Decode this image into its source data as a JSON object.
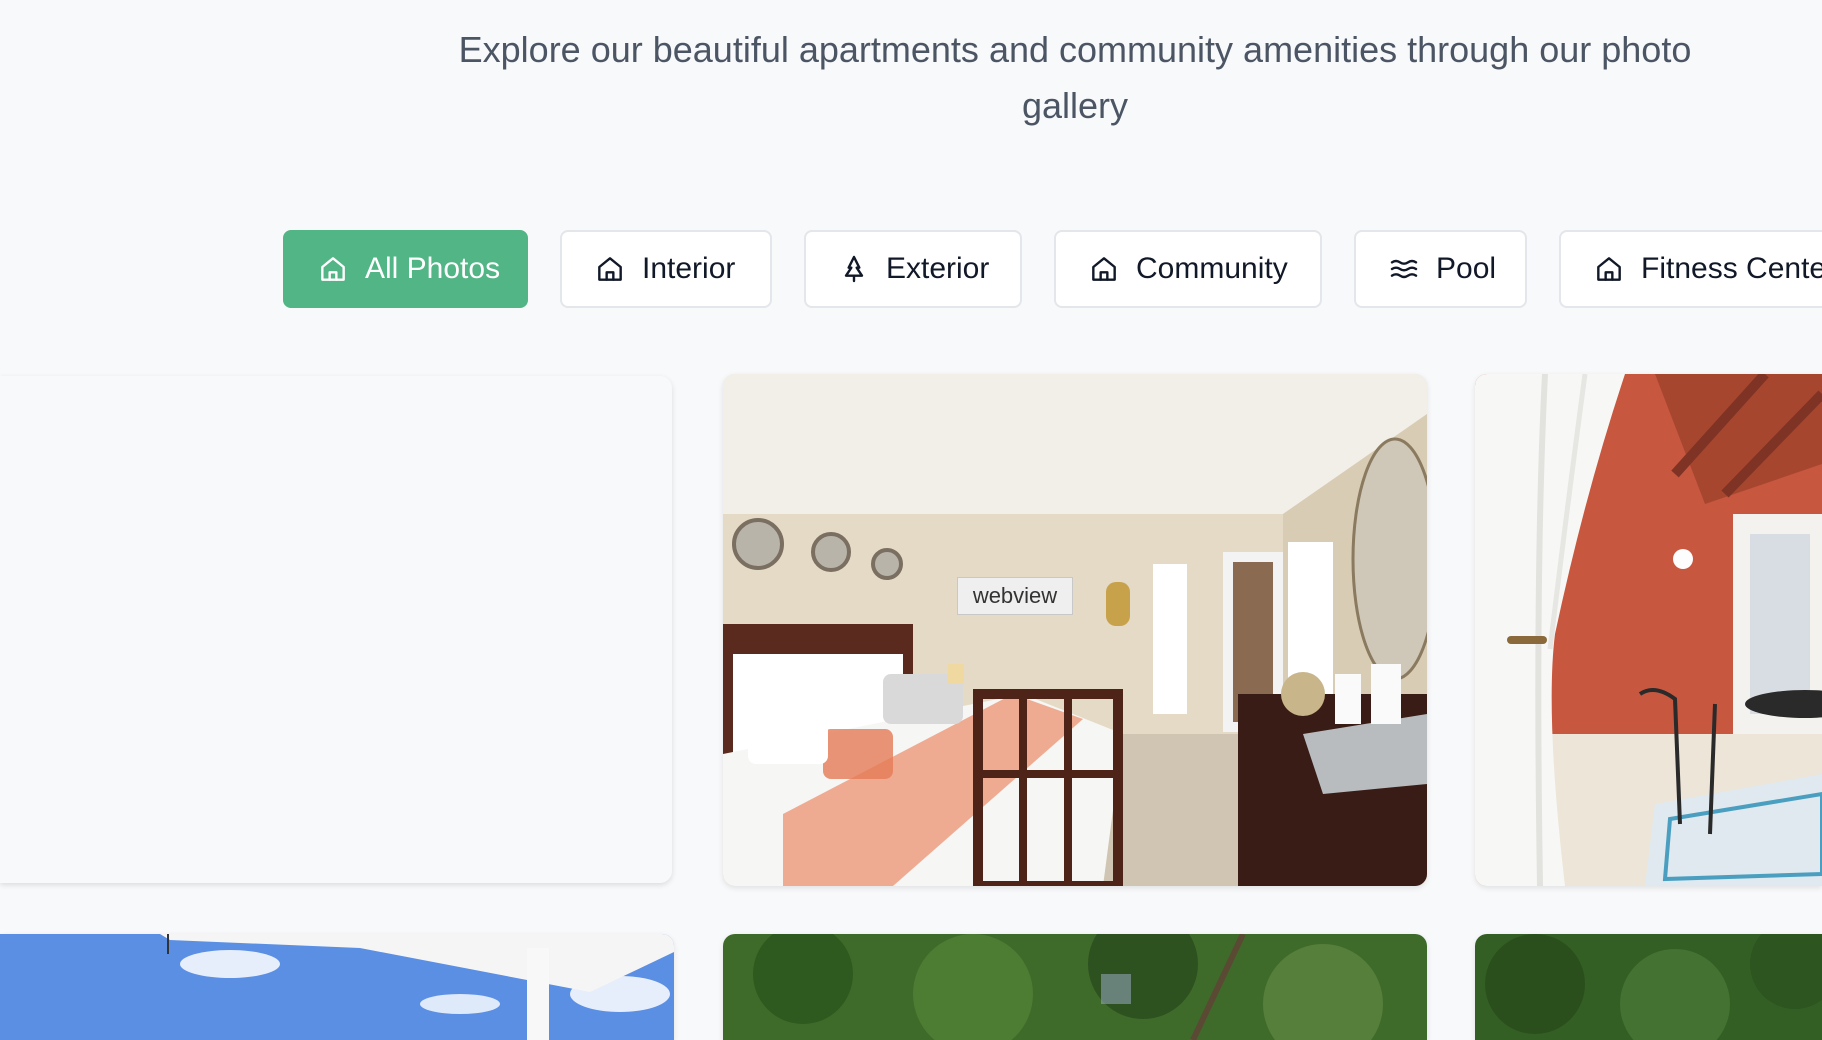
{
  "header": {
    "subtitle": "Explore our beautiful apartments and community amenities through our photo gallery"
  },
  "filters": [
    {
      "label": "All Photos",
      "icon": "home-icon",
      "active": true
    },
    {
      "label": "Interior",
      "icon": "home-icon",
      "active": false
    },
    {
      "label": "Exterior",
      "icon": "tree-icon",
      "active": false
    },
    {
      "label": "Community",
      "icon": "home-icon",
      "active": false
    },
    {
      "label": "Pool",
      "icon": "waves-icon",
      "active": false
    },
    {
      "label": "Fitness Cente",
      "icon": "home-icon",
      "active": false
    }
  ],
  "gallery": {
    "tooltip": "webview"
  },
  "colors": {
    "accent": "#52b585",
    "background": "#f8f9fb",
    "text_muted": "#4b5563"
  }
}
